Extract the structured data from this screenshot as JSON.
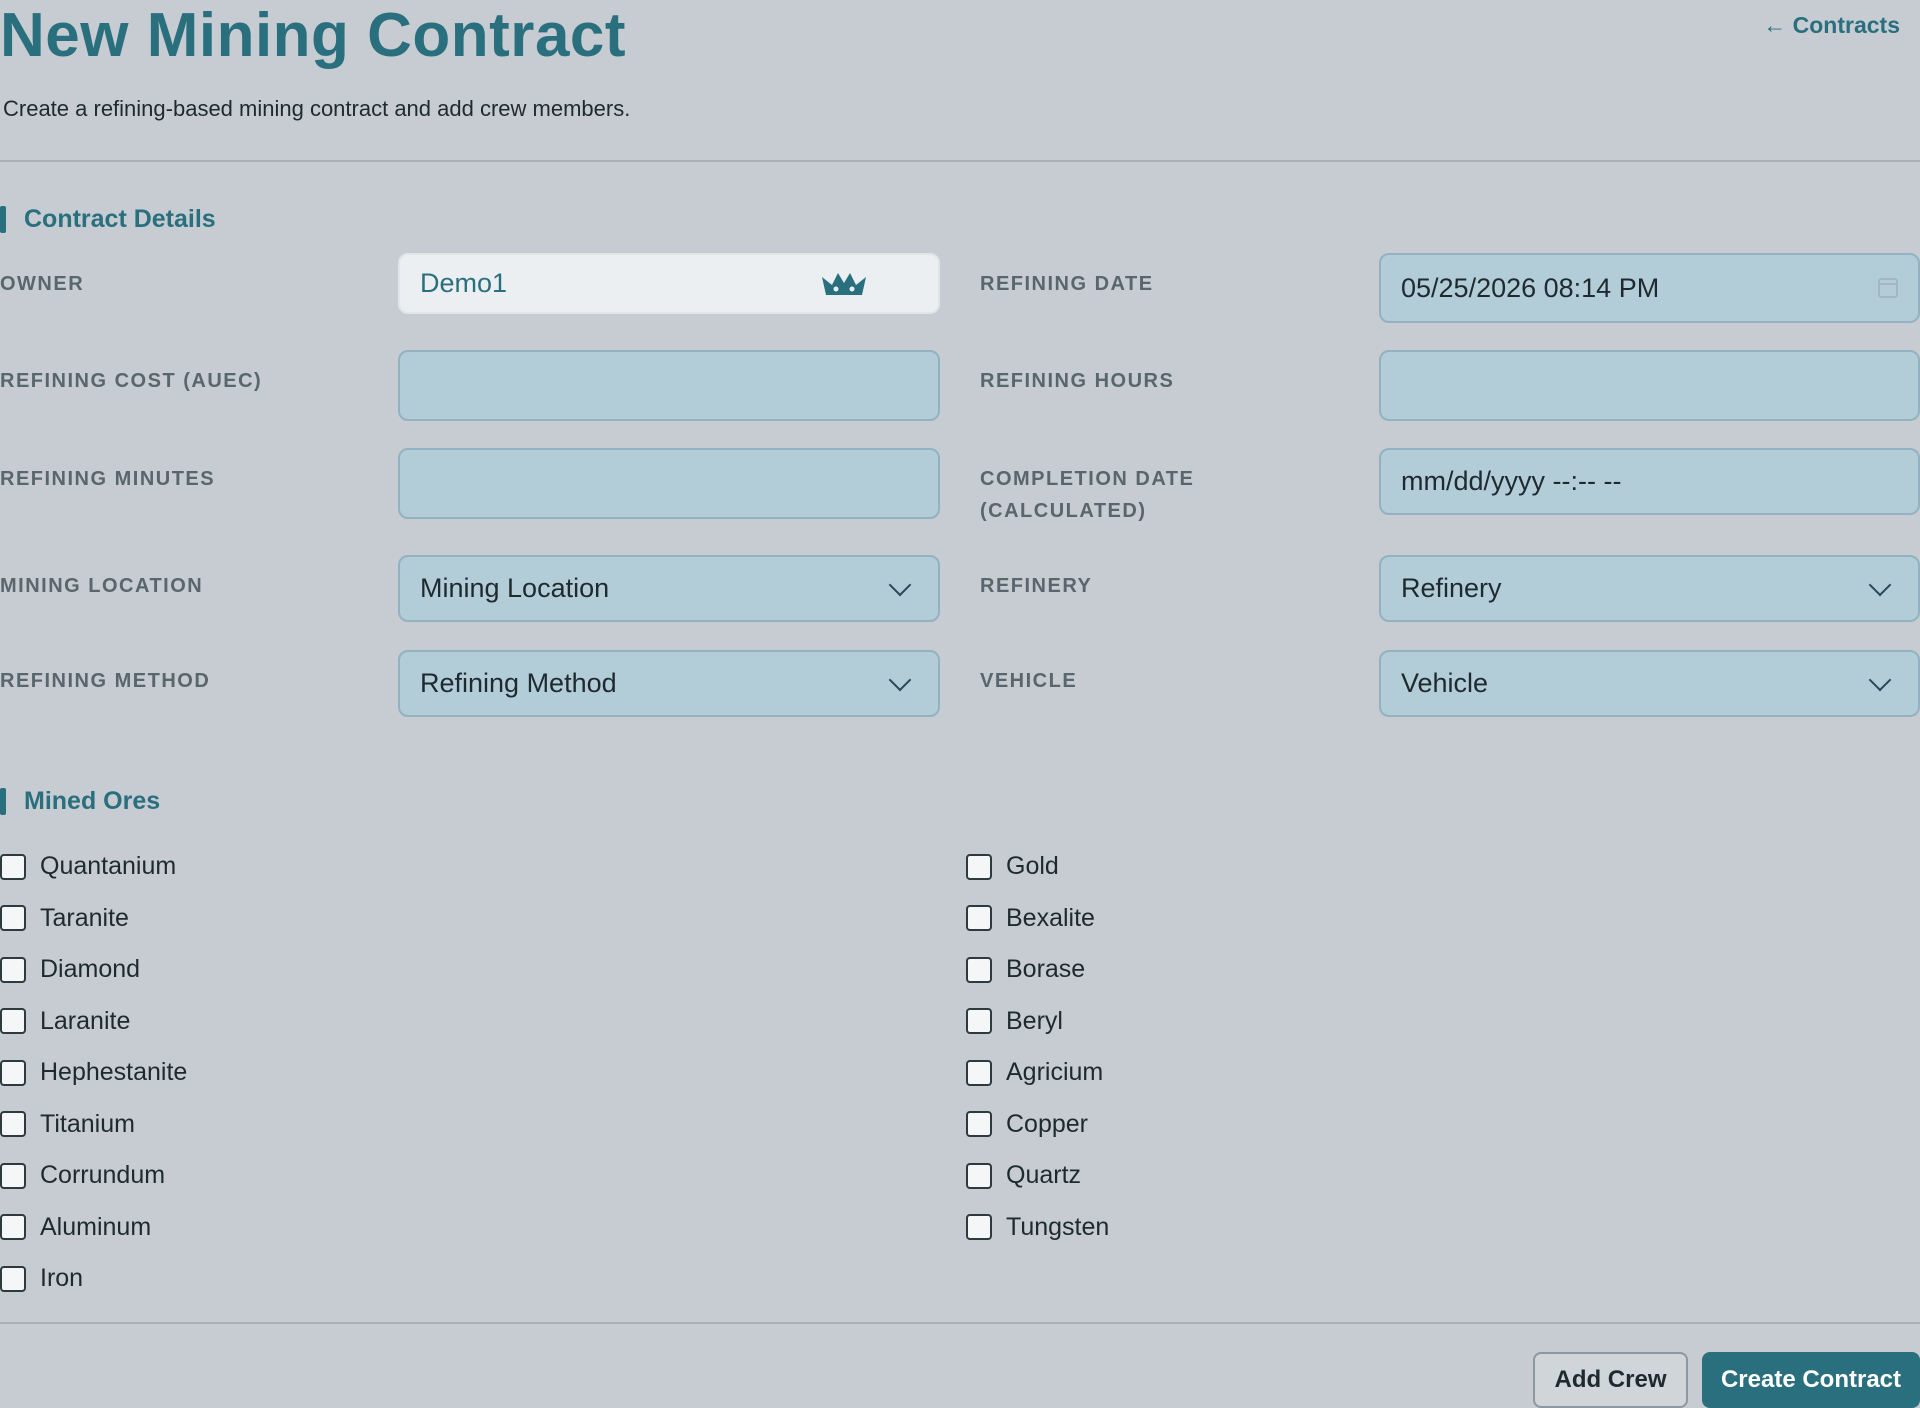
{
  "header": {
    "title": "New Mining Contract",
    "back_link": "← Contracts",
    "subtitle": "Create a refining-based mining contract and add crew members."
  },
  "sections": {
    "contract_details": "Contract Details",
    "mined_ores": "Mined Ores"
  },
  "form": {
    "owner": {
      "label": "OWNER",
      "value": "Demo1",
      "icon": "crown-icon"
    },
    "refining_date": {
      "label": "REFINING DATE",
      "value": "05/25/2026 08:14  PM",
      "icon": "calendar-icon"
    },
    "refining_cost": {
      "label": "REFINING COST (AUEC)",
      "value": ""
    },
    "refining_hours": {
      "label": "REFINING HOURS",
      "value": ""
    },
    "refining_minutes": {
      "label": "REFINING MINUTES",
      "value": ""
    },
    "completion_date": {
      "label_line1": "COMPLETION DATE",
      "label_line2": "(CALCULATED)",
      "value": "mm/dd/yyyy --:--  --"
    },
    "mining_location": {
      "label": "MINING LOCATION",
      "selected": "Mining Location"
    },
    "refinery": {
      "label": "REFINERY",
      "selected": "Refinery"
    },
    "refining_method": {
      "label": "REFINING METHOD",
      "selected": "Refining Method"
    },
    "vehicle": {
      "label": "VEHICLE",
      "selected": "Vehicle"
    }
  },
  "ores": {
    "left": [
      "Quantanium",
      "Taranite",
      "Diamond",
      "Laranite",
      "Hephestanite",
      "Titanium",
      "Corrundum",
      "Aluminum",
      "Iron"
    ],
    "right": [
      "Gold",
      "Bexalite",
      "Borase",
      "Beryl",
      "Agricium",
      "Copper",
      "Quartz",
      "Tungsten"
    ]
  },
  "actions": {
    "add_crew": "Add Crew",
    "create_contract": "Create Contract"
  },
  "colors": {
    "accent": "#2a6f7e",
    "background": "#c6ccd1",
    "input_fill": "#b2cdd8"
  }
}
